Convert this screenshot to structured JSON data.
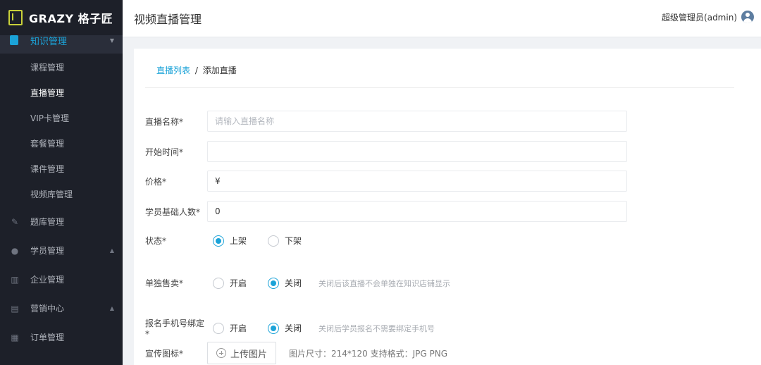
{
  "app": {
    "logo_text": "GRAZY 格子匠"
  },
  "sidebar": {
    "active_group": "知识管理",
    "sub_items": [
      {
        "label": "课程管理"
      },
      {
        "label": "直播管理"
      },
      {
        "label": "VIP卡管理"
      },
      {
        "label": "套餐管理"
      },
      {
        "label": "课件管理"
      },
      {
        "label": "视频库管理"
      }
    ],
    "current_sub": "直播管理",
    "main_items": [
      {
        "label": "题库管理",
        "icon": "pencil-icon"
      },
      {
        "label": "学员管理",
        "icon": "user-icon"
      },
      {
        "label": "企业管理",
        "icon": "building-icon"
      },
      {
        "label": "营销中心",
        "icon": "briefcase-icon"
      },
      {
        "label": "订单管理",
        "icon": "clipboard-icon"
      }
    ]
  },
  "header": {
    "title": "视频直播管理",
    "user": "超级管理员(admin)"
  },
  "breadcrumb": {
    "link": "直播列表",
    "separator": "/",
    "current": "添加直播"
  },
  "form": {
    "name": {
      "label": "直播名称*",
      "placeholder": "请输入直播名称",
      "value": ""
    },
    "start_time": {
      "label": "开始时间*",
      "value": ""
    },
    "price": {
      "label": "价格*",
      "value": "¥"
    },
    "base_students": {
      "label": "学员基础人数*",
      "value": "0"
    },
    "status": {
      "label": "状态*",
      "options": [
        "上架",
        "下架"
      ],
      "selected": "上架"
    },
    "sell_alone": {
      "label": "单独售卖*",
      "options": [
        "开启",
        "关闭"
      ],
      "selected": "关闭",
      "hint": "关闭后该直播不会单独在知识店铺显示"
    },
    "phone_bind": {
      "label": "报名手机号绑定*",
      "options": [
        "开启",
        "关闭"
      ],
      "selected": "关闭",
      "hint": "关闭后学员报名不需要绑定手机号"
    },
    "promo_icon": {
      "label": "宣传图标*",
      "button": "上传图片",
      "hint": "图片尺寸：214*120 支持格式：JPG PNG"
    }
  },
  "colors": {
    "accent": "#1ba3d8",
    "sidebar_bg": "#1d2029",
    "logo": "#c9d13a"
  }
}
